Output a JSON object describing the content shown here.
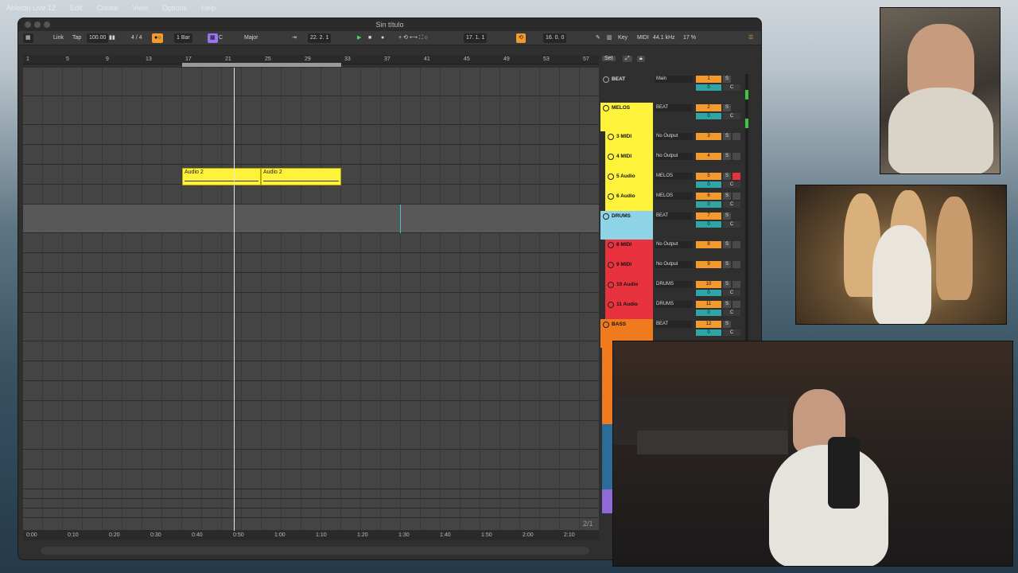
{
  "os_menubar": {
    "items": [
      "Ableton Live 12",
      "Edit",
      "Create",
      "View",
      "Options",
      "Help"
    ]
  },
  "window": {
    "title": "Sin título"
  },
  "toolbar": {
    "link": "Link",
    "tap": "Tap",
    "tempo": "100.00",
    "signature": "4 / 4",
    "quantize": "1 Bar",
    "key": "C",
    "scale": "Major",
    "arrangement_position": "22.  2.  1",
    "loop_start": "17.  1.  1",
    "loop_length": "16.  0.  0",
    "key_label": "Key",
    "midi_label": "MIDI",
    "sample_rate": "44.1 kHz",
    "cpu": "17 %"
  },
  "ruler": {
    "bars": [
      "1",
      "5",
      "9",
      "13",
      "17",
      "21",
      "25",
      "29",
      "33",
      "37",
      "41",
      "45",
      "49",
      "53",
      "57"
    ]
  },
  "time_ruler": {
    "labels": [
      "0:00",
      "0:10",
      "0:20",
      "0:30",
      "0:40",
      "0:50",
      "1:00",
      "1:10",
      "1:20",
      "1:30",
      "1:40",
      "1:50",
      "2:00",
      "2:10"
    ]
  },
  "clips": [
    {
      "label": "Audio 2"
    },
    {
      "label": "Audio 2"
    }
  ],
  "page_indicator": "2/1",
  "mixer_header": {
    "set": "Set"
  },
  "tracks": [
    {
      "name": "BEAT",
      "route": "Main",
      "num": "1",
      "vol": "0",
      "pan": "C",
      "color": "#2f2f2f",
      "meter": true
    },
    {
      "name": "MELOS",
      "route": "BEAT",
      "num": "2",
      "vol": "0",
      "pan": "C",
      "color": "#fff23a",
      "meter": true
    },
    {
      "name": "3 MIDI",
      "route": "No Output",
      "num": "3",
      "vol": "",
      "pan": "",
      "color": "#fff23a",
      "meter": false
    },
    {
      "name": "4 MIDI",
      "route": "No Output",
      "num": "4",
      "vol": "",
      "pan": "",
      "color": "#fff23a",
      "meter": false
    },
    {
      "name": "5 Audio",
      "route": "MELOS",
      "num": "5",
      "vol": "0",
      "pan": "C",
      "color": "#fff23a",
      "meter": false
    },
    {
      "name": "6 Audio",
      "route": "MELOS",
      "num": "6",
      "vol": "0",
      "pan": "C",
      "color": "#fff23a",
      "meter": false
    },
    {
      "name": "DRUMS",
      "route": "BEAT",
      "num": "7",
      "vol": "0",
      "pan": "C",
      "color": "#8fd3e6",
      "meter": false
    },
    {
      "name": "8 MIDI",
      "route": "No Output",
      "num": "8",
      "vol": "",
      "pan": "",
      "color": "#e8333f",
      "meter": false
    },
    {
      "name": "9 MIDI",
      "route": "No Output",
      "num": "9",
      "vol": "",
      "pan": "",
      "color": "#e8333f",
      "meter": false
    },
    {
      "name": "10 Audio",
      "route": "DRUMS",
      "num": "10",
      "vol": "0",
      "pan": "C",
      "color": "#e8333f",
      "meter": false
    },
    {
      "name": "11 Audio",
      "route": "DRUMS",
      "num": "11",
      "vol": "0",
      "pan": "C",
      "color": "#e8333f",
      "meter": false
    },
    {
      "name": "BASS",
      "route": "BEAT",
      "num": "12",
      "vol": "0",
      "pan": "C",
      "color": "#f07a1e",
      "meter": false
    }
  ],
  "colors": {
    "accent": "#f29a2e",
    "clip": "#fff23a",
    "teal": "#2fa5a5"
  }
}
